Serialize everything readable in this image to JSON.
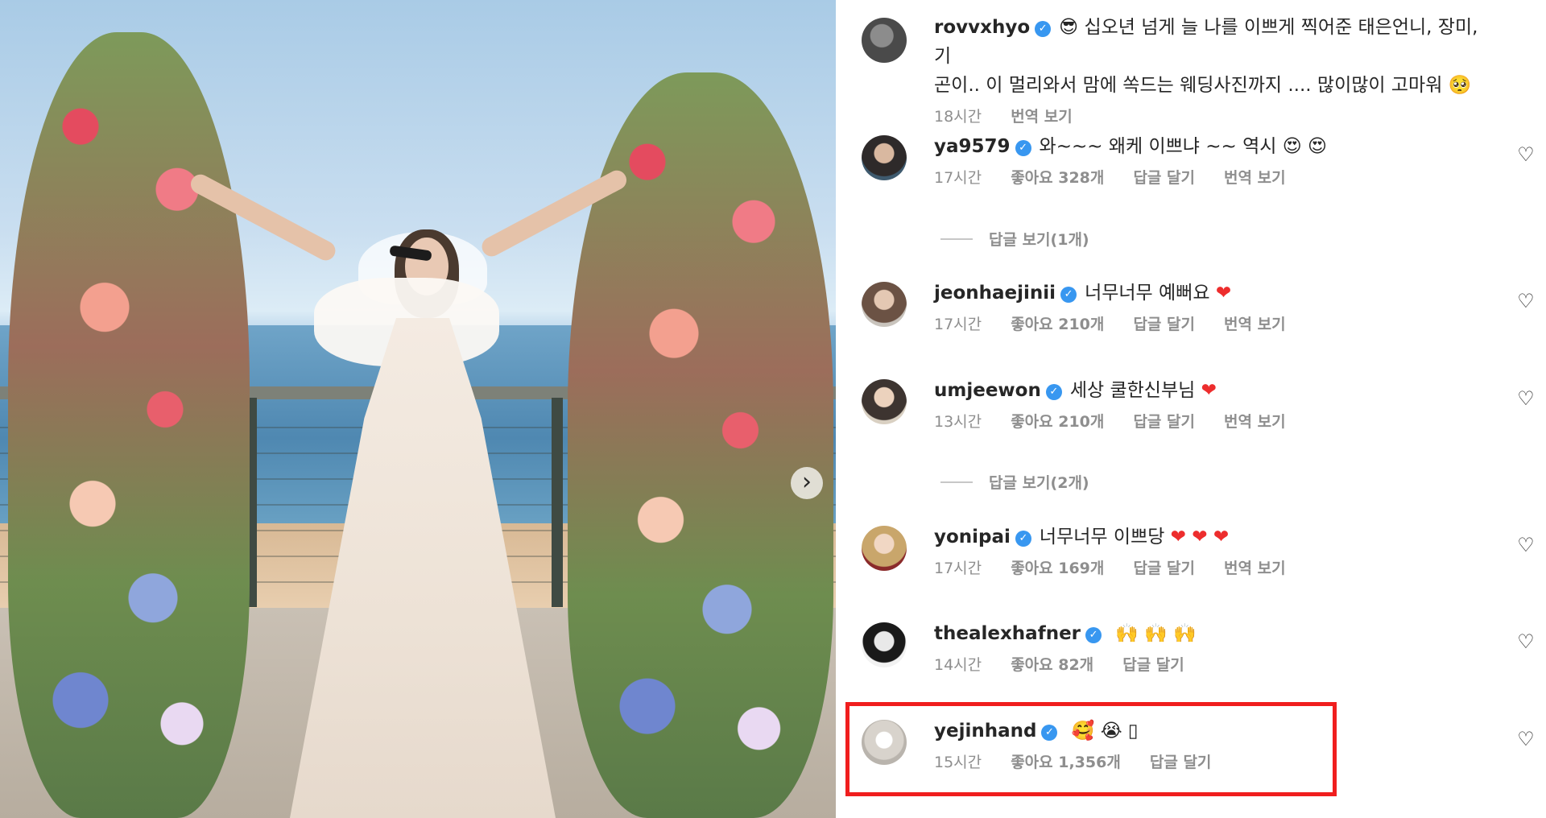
{
  "post": {
    "image_description_icon": "wedding-photo",
    "carousel_next_icon": "chevron-right-icon",
    "carousel_next_glyph": "›"
  },
  "comments": [
    {
      "username": "rovvxhyo",
      "text_line1": "십오년 넘게 늘 나를 이쁘게 찍어준 태은언니, 장미, 기",
      "text_line2": "곤이.. 이 멀리와서 맘에 쏙드는 웨딩사진까지 .... 많이많이 고마워",
      "emoji_lead": "😎",
      "emoji_tail": "🥺",
      "time": "18시간",
      "translate": "번역 보기"
    },
    {
      "username": "ya9579",
      "text": "와~~~ 왜케 이쁘냐 ~~ 역시",
      "emoji_tail": "😍 😍",
      "time": "17시간",
      "likes": "좋아요 328개",
      "reply": "답글 달기",
      "translate": "번역 보기",
      "view_replies": "답글 보기(1개)"
    },
    {
      "username": "jeonhaejinii",
      "text": "너무너무 예뻐요",
      "emoji_tail": "❤",
      "time": "17시간",
      "likes": "좋아요 210개",
      "reply": "답글 달기",
      "translate": "번역 보기"
    },
    {
      "username": "umjeewon",
      "text": "세상 쿨한신부님",
      "emoji_tail": "❤",
      "time": "13시간",
      "likes": "좋아요 210개",
      "reply": "답글 달기",
      "translate": "번역 보기",
      "view_replies": "답글 보기(2개)"
    },
    {
      "username": "yonipai",
      "text": "너무너무 이쁘당",
      "emoji_tail": "❤ ❤ ❤",
      "time": "17시간",
      "likes": "좋아요 169개",
      "reply": "답글 달기",
      "translate": "번역 보기"
    },
    {
      "username": "thealexhafner",
      "text": "",
      "emoji_tail": "🙌 🙌 🙌",
      "time": "14시간",
      "likes": "좋아요 82개",
      "reply": "답글 달기"
    },
    {
      "username": "yejinhand",
      "text": "",
      "emoji_tail": "🥰 😭 ▯",
      "time": "15시간",
      "likes": "좋아요 1,356개",
      "reply": "답글 달기"
    }
  ],
  "icons": {
    "verified_glyph": "✓",
    "like_glyph": "♡"
  },
  "colors": {
    "highlight": "#f01e1e",
    "verified": "#3897f0",
    "heart": "#ed2d2d"
  }
}
